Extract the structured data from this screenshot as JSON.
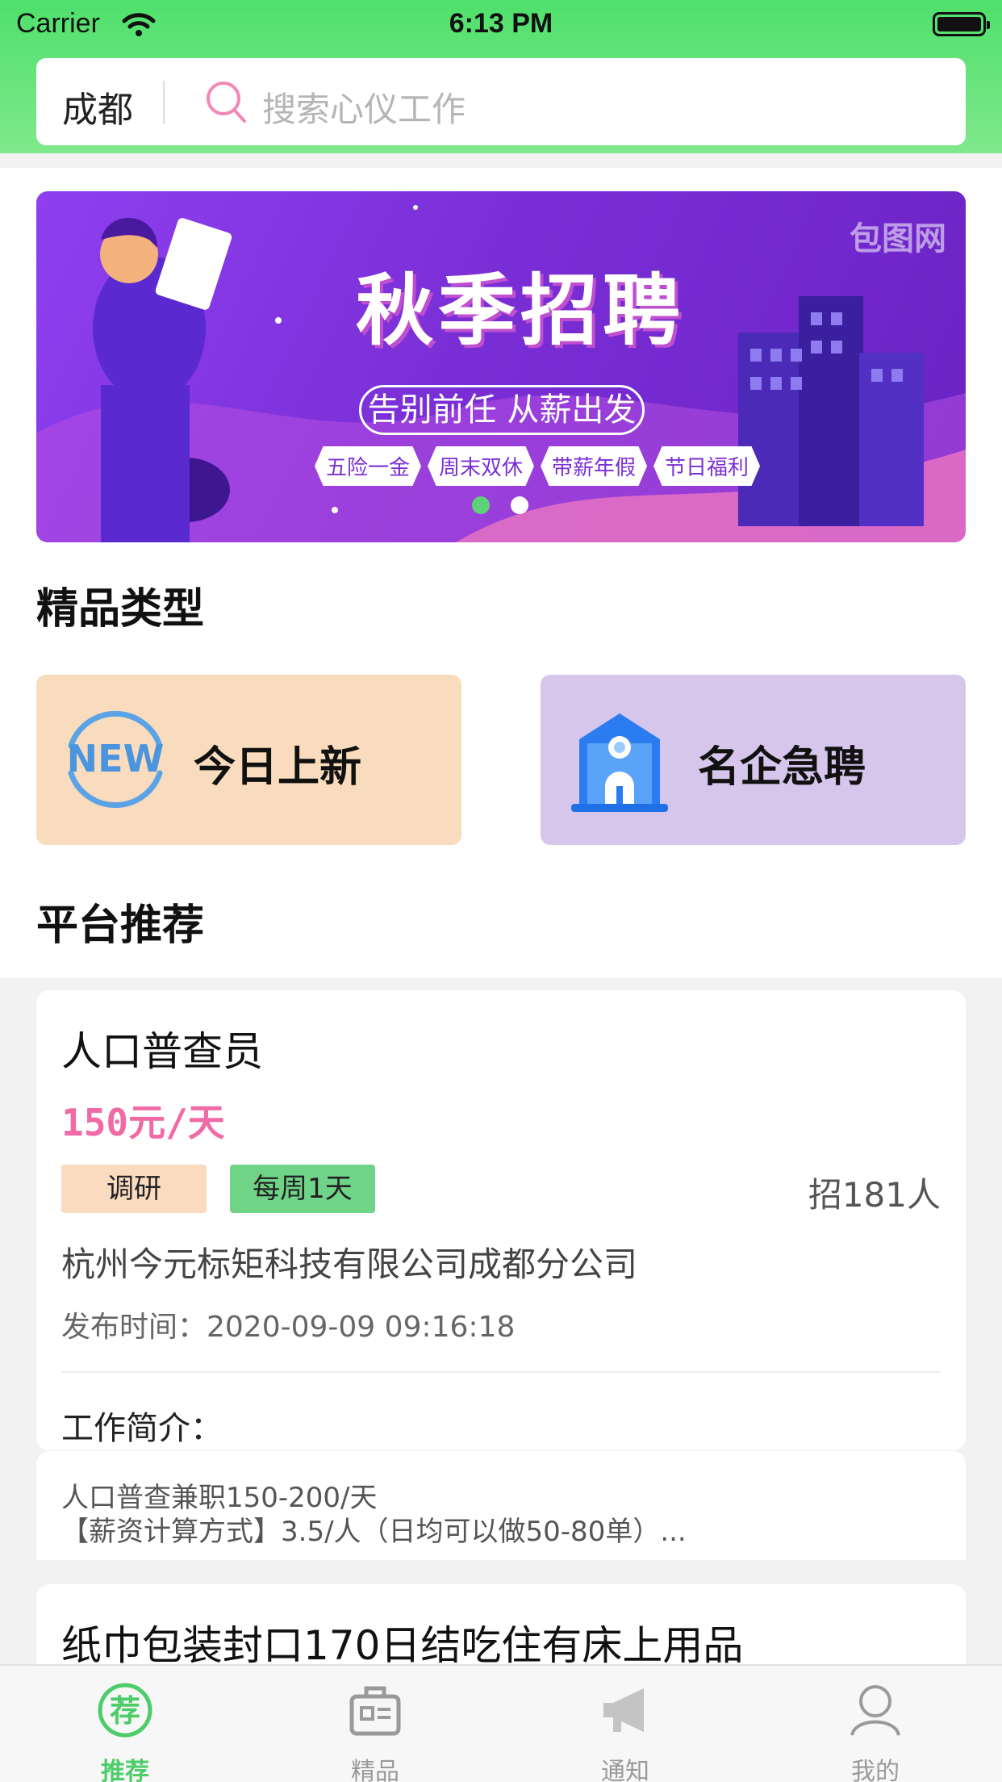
{
  "status_bar": {
    "carrier": "Carrier",
    "time": "6:13 PM"
  },
  "search": {
    "city": "成都",
    "placeholder": "搜索心仪工作"
  },
  "banner": {
    "logo": "包图网",
    "title": "秋季招聘",
    "subtitle": "告别前任 从薪出发",
    "tags": [
      "五险一金",
      "周末双休",
      "带薪年假",
      "节日福利"
    ],
    "page_count": 2,
    "active_page": 1
  },
  "sections": {
    "premium_types": "精品类型",
    "platform_recommend": "平台推荐"
  },
  "categories": [
    {
      "label": "今日上新",
      "icon": "new-badge-icon",
      "bg": "#f9dcbd"
    },
    {
      "label": "名企急聘",
      "icon": "corporate-building-icon",
      "bg": "#d6c6ec"
    }
  ],
  "jobs": [
    {
      "title": "人口普查员",
      "salary": "150元/天",
      "tags": [
        "调研",
        "每周1天"
      ],
      "count": "招181人",
      "company": "杭州今元标矩科技有限公司成都分公司",
      "date": "发布时间：2020-09-09 09:16:18",
      "intro_label": "工作简介：",
      "description": [
        "人口普查兼职150-200/天",
        "【薪资计算方式】3.5/人（日均可以做50-80单）..."
      ]
    },
    {
      "title": "纸巾包装封口170日结吃住有床上用品"
    }
  ],
  "tabbar": [
    {
      "label": "推荐",
      "icon": "recommend-icon",
      "active": true
    },
    {
      "label": "精品",
      "icon": "briefcase-icon",
      "active": false
    },
    {
      "label": "通知",
      "icon": "megaphone-icon",
      "active": false
    },
    {
      "label": "我的",
      "icon": "user-icon",
      "active": false
    }
  ],
  "colors": {
    "accent_green": "#4dcc6a",
    "salary_pink": "#f06aa6",
    "banner_purple": "#7a2fd6"
  }
}
